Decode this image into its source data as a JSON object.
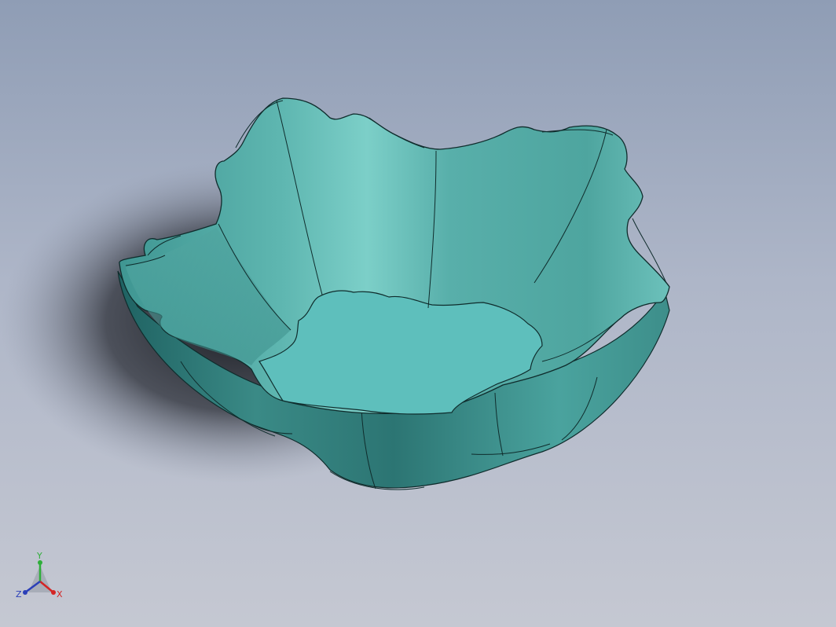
{
  "viewport": {
    "colors": {
      "background_top": "#8f9db5",
      "background_bottom": "#c5c8d2",
      "model_face": "#5fb8b3",
      "model_edge": "#0f2c2c",
      "floor": "#5ebfbc",
      "shadow": "#1a1c22"
    }
  },
  "model": {
    "name_icon": "fluted-bowl-part"
  },
  "triad": {
    "x_label": "X",
    "y_label": "Y",
    "z_label": "Z",
    "x_color": "#d42525",
    "y_color": "#2fae3a",
    "z_color": "#2b3fb8"
  }
}
